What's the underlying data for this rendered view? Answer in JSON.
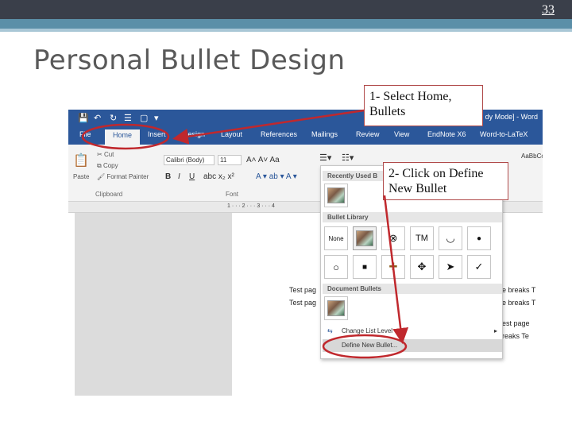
{
  "slide": {
    "number": "33",
    "title": "Personal Bullet Design"
  },
  "callouts": {
    "step1": "1- Select Home, Bullets",
    "step2": "2- Click on Define New Bullet"
  },
  "word": {
    "title_right": "dy Mode] - Word",
    "tabs": [
      "File",
      "Home",
      "Insert",
      "Design",
      "Layout",
      "References",
      "Mailings",
      "Review",
      "View",
      "EndNote X6",
      "Word-to-LaTeX"
    ],
    "active_tab": "Home",
    "clipboard": {
      "paste": "Paste",
      "cut": "Cut",
      "copy": "Copy",
      "format_painter": "Format Painter",
      "group_label": "Clipboard"
    },
    "font": {
      "name": "Calibri (Body)",
      "size": "11",
      "group_label": "Font"
    },
    "styles_hint": "AaBbCcDc",
    "doc_lines": [
      "Test pag",
      "Test pag"
    ],
    "doc_right_lines": [
      "e breaks T",
      "e breaks T",
      "est page",
      "reaks Te"
    ]
  },
  "dropdown": {
    "recent_header": "Recently Used B",
    "library_header": "Bullet Library",
    "none_label": "None",
    "symbols": [
      "⊗",
      "TM",
      "◡",
      "●",
      "○",
      "■",
      "✚",
      "✥",
      "➤",
      "✓"
    ],
    "document_header": "Document Bullets",
    "change_level": "Change List Level",
    "define_new": "Define New Bullet..."
  },
  "colors": {
    "word_blue": "#2b579a",
    "annotation_red": "#c0282d",
    "slide_accent": "#5b8fa8"
  }
}
